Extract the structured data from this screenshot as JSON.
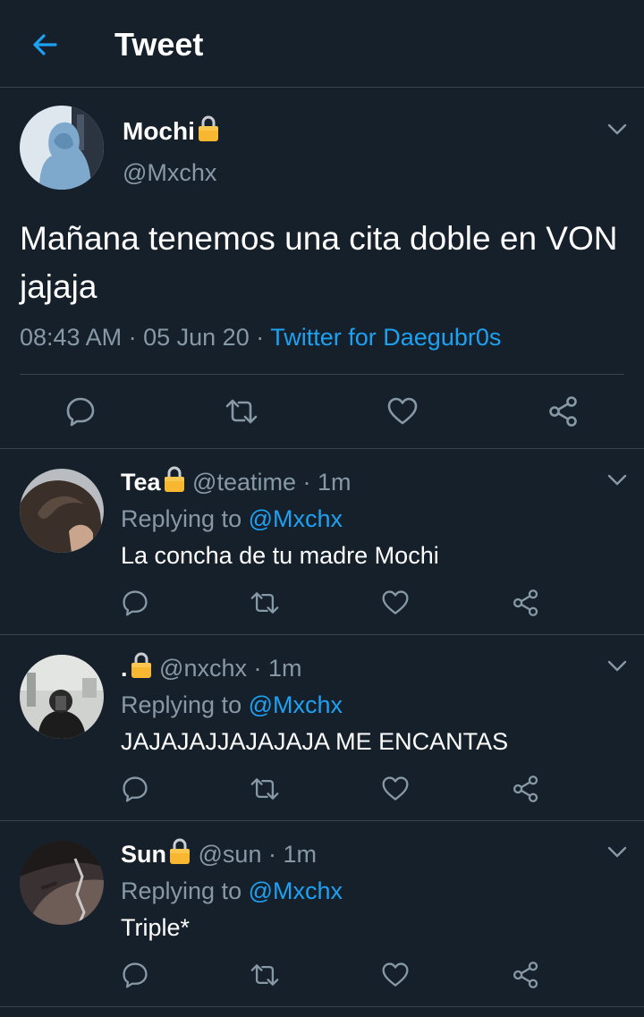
{
  "colors": {
    "background": "#15202b",
    "accent": "#1da1f2",
    "muted": "#8899a6",
    "divider": "#38444d"
  },
  "header": {
    "title": "Tweet",
    "back_icon": "arrow-left-icon"
  },
  "main_tweet": {
    "name": "Mochi",
    "handle": "@Mxchx",
    "text": "Mañana tenemos una cita doble en VON jajaja",
    "time": "08:43 AM",
    "date": "05 Jun 20",
    "client": "Twitter for Daegubr0s",
    "sep": "·"
  },
  "replies": [
    {
      "name": "Tea",
      "handle": "@teatime",
      "time": "1m",
      "replying_prefix": "Replying to",
      "replying_to": "@Mxchx",
      "text": "La concha de tu madre Mochi"
    },
    {
      "name": ".",
      "handle": "@nxchx",
      "time": "1m",
      "replying_prefix": "Replying to",
      "replying_to": "@Mxchx",
      "text": "JAJAJAJJAJAJAJA ME ENCANTAS"
    },
    {
      "name": "Sun",
      "handle": "@sun",
      "time": "1m",
      "replying_prefix": "Replying to",
      "replying_to": "@Mxchx",
      "text": "Triple*"
    }
  ]
}
